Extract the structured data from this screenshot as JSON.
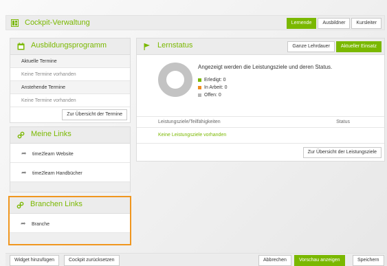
{
  "header": {
    "title": "Cockpit-Verwaltung",
    "roles": [
      "Lernende",
      "Ausbildner",
      "Kursleiter"
    ],
    "active_role": "Lernende"
  },
  "ausbildungsprogramm": {
    "title": "Ausbildungsprogramm",
    "current_label": "Aktuelle Termine",
    "current_empty": "Keine Termine vorhanden",
    "upcoming_label": "Anstehende Termine",
    "upcoming_empty": "Keine Termine vorhanden",
    "overview_button": "Zur Übersicht der Termine"
  },
  "meine_links": {
    "title": "Meine Links",
    "items": [
      "time2learn Website",
      "time2learn Handbücher"
    ]
  },
  "branchen_links": {
    "title": "Branchen Links",
    "items": [
      "Branche"
    ]
  },
  "lernstatus": {
    "title": "Lernstatus",
    "tabs": [
      "Ganze Lehrdauer",
      "Aktueller Einsatz"
    ],
    "active_tab": "Aktueller Einsatz",
    "description": "Angezeigt werden die Leistungsziele und deren Status.",
    "legend": [
      {
        "label": "Erledigt:",
        "value": "0",
        "color": "#7ab800"
      },
      {
        "label": "In Arbeit:",
        "value": "0",
        "color": "#f08c1e"
      },
      {
        "label": "Offen:",
        "value": "0",
        "color": "#b5b5b5"
      }
    ],
    "table_header_left": "Leistungsziele/Teilfähigkeiten",
    "table_header_right": "Status",
    "empty_text": "Keine Leistungsziele vorhanden",
    "overview_button": "Zur Übersicht der Leistungsziele"
  },
  "footer": {
    "add_widget": "Widget hinzufügen",
    "reset": "Cockpit zurücksetzen",
    "cancel": "Abbrechen",
    "preview": "Vorschau anzeigen",
    "save": "Speichern"
  },
  "colors": {
    "accent": "#7ab800",
    "highlight": "#f0961e"
  }
}
